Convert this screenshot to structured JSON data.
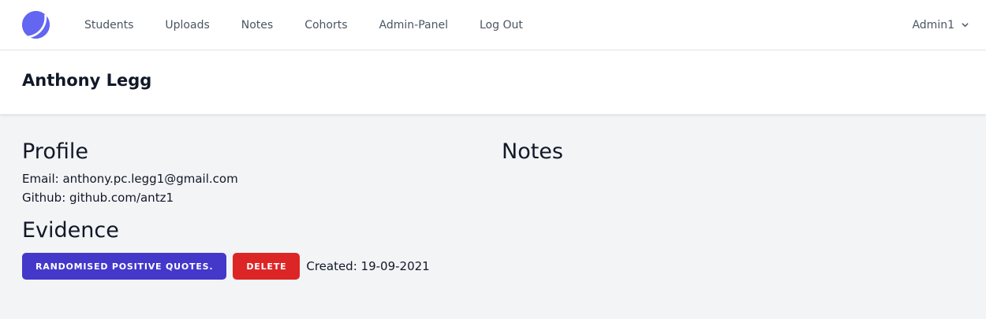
{
  "nav": {
    "links": [
      "Students",
      "Uploads",
      "Notes",
      "Cohorts",
      "Admin-Panel",
      "Log Out"
    ],
    "user": "Admin1",
    "accent_color": "#6366f1"
  },
  "header": {
    "title": "Anthony Legg"
  },
  "profile": {
    "heading": "Profile",
    "email": "Email: anthony.pc.legg1@gmail.com",
    "github": "Github: github.com/antz1"
  },
  "evidence": {
    "heading": "Evidence",
    "items": [
      {
        "title_button": "RANDOMISED POSITIVE QUOTES.",
        "delete_label": "DELETE",
        "created": "Created: 19-09-2021"
      }
    ]
  },
  "notes": {
    "heading": "Notes"
  },
  "colors": {
    "primary_button": "#4338ca",
    "danger_button": "#dc2626",
    "background": "#f3f4f6"
  }
}
